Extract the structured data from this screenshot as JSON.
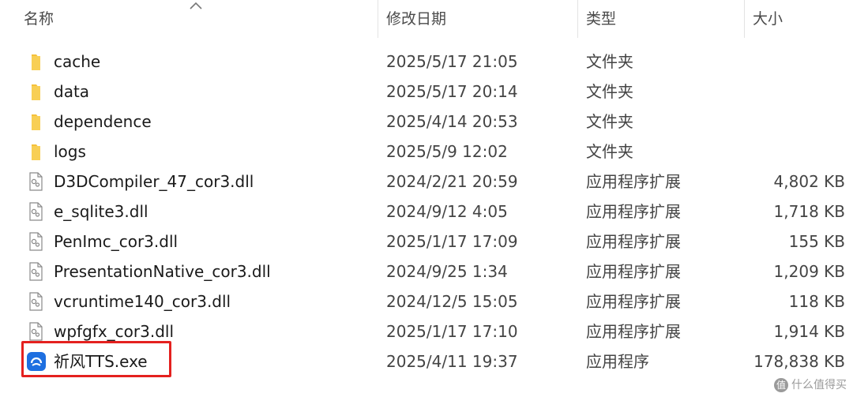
{
  "columns": {
    "name": "名称",
    "date": "修改日期",
    "type": "类型",
    "size": "大小"
  },
  "files": [
    {
      "name": "cache",
      "date": "2025/5/17 21:05",
      "type": "文件夹",
      "size": "",
      "icon": "folder-icon"
    },
    {
      "name": "data",
      "date": "2025/5/17 20:14",
      "type": "文件夹",
      "size": "",
      "icon": "folder-icon"
    },
    {
      "name": "dependence",
      "date": "2025/4/14 20:53",
      "type": "文件夹",
      "size": "",
      "icon": "folder-icon"
    },
    {
      "name": "logs",
      "date": "2025/5/9 12:02",
      "type": "文件夹",
      "size": "",
      "icon": "folder-icon"
    },
    {
      "name": "D3DCompiler_47_cor3.dll",
      "date": "2024/2/21 20:59",
      "type": "应用程序扩展",
      "size": "4,802 KB",
      "icon": "dll-file-icon"
    },
    {
      "name": "e_sqlite3.dll",
      "date": "2024/9/12 4:05",
      "type": "应用程序扩展",
      "size": "1,718 KB",
      "icon": "dll-file-icon"
    },
    {
      "name": "PenImc_cor3.dll",
      "date": "2025/1/17 17:09",
      "type": "应用程序扩展",
      "size": "155 KB",
      "icon": "dll-file-icon"
    },
    {
      "name": "PresentationNative_cor3.dll",
      "date": "2024/9/25 1:34",
      "type": "应用程序扩展",
      "size": "1,209 KB",
      "icon": "dll-file-icon"
    },
    {
      "name": "vcruntime140_cor3.dll",
      "date": "2024/12/5 15:05",
      "type": "应用程序扩展",
      "size": "118 KB",
      "icon": "dll-file-icon"
    },
    {
      "name": "wpfgfx_cor3.dll",
      "date": "2025/1/17 17:10",
      "type": "应用程序扩展",
      "size": "1,914 KB",
      "icon": "dll-file-icon"
    },
    {
      "name": "祈风TTS.exe",
      "date": "2025/4/11 19:37",
      "type": "应用程序",
      "size": "178,838 KB",
      "icon": "app-exe-icon"
    }
  ],
  "watermark": {
    "logo": "值",
    "text": "什么值得买"
  },
  "colors": {
    "folder": "#f5c13b",
    "highlight": "#e4211f",
    "app_icon": "#1e6fe0"
  }
}
